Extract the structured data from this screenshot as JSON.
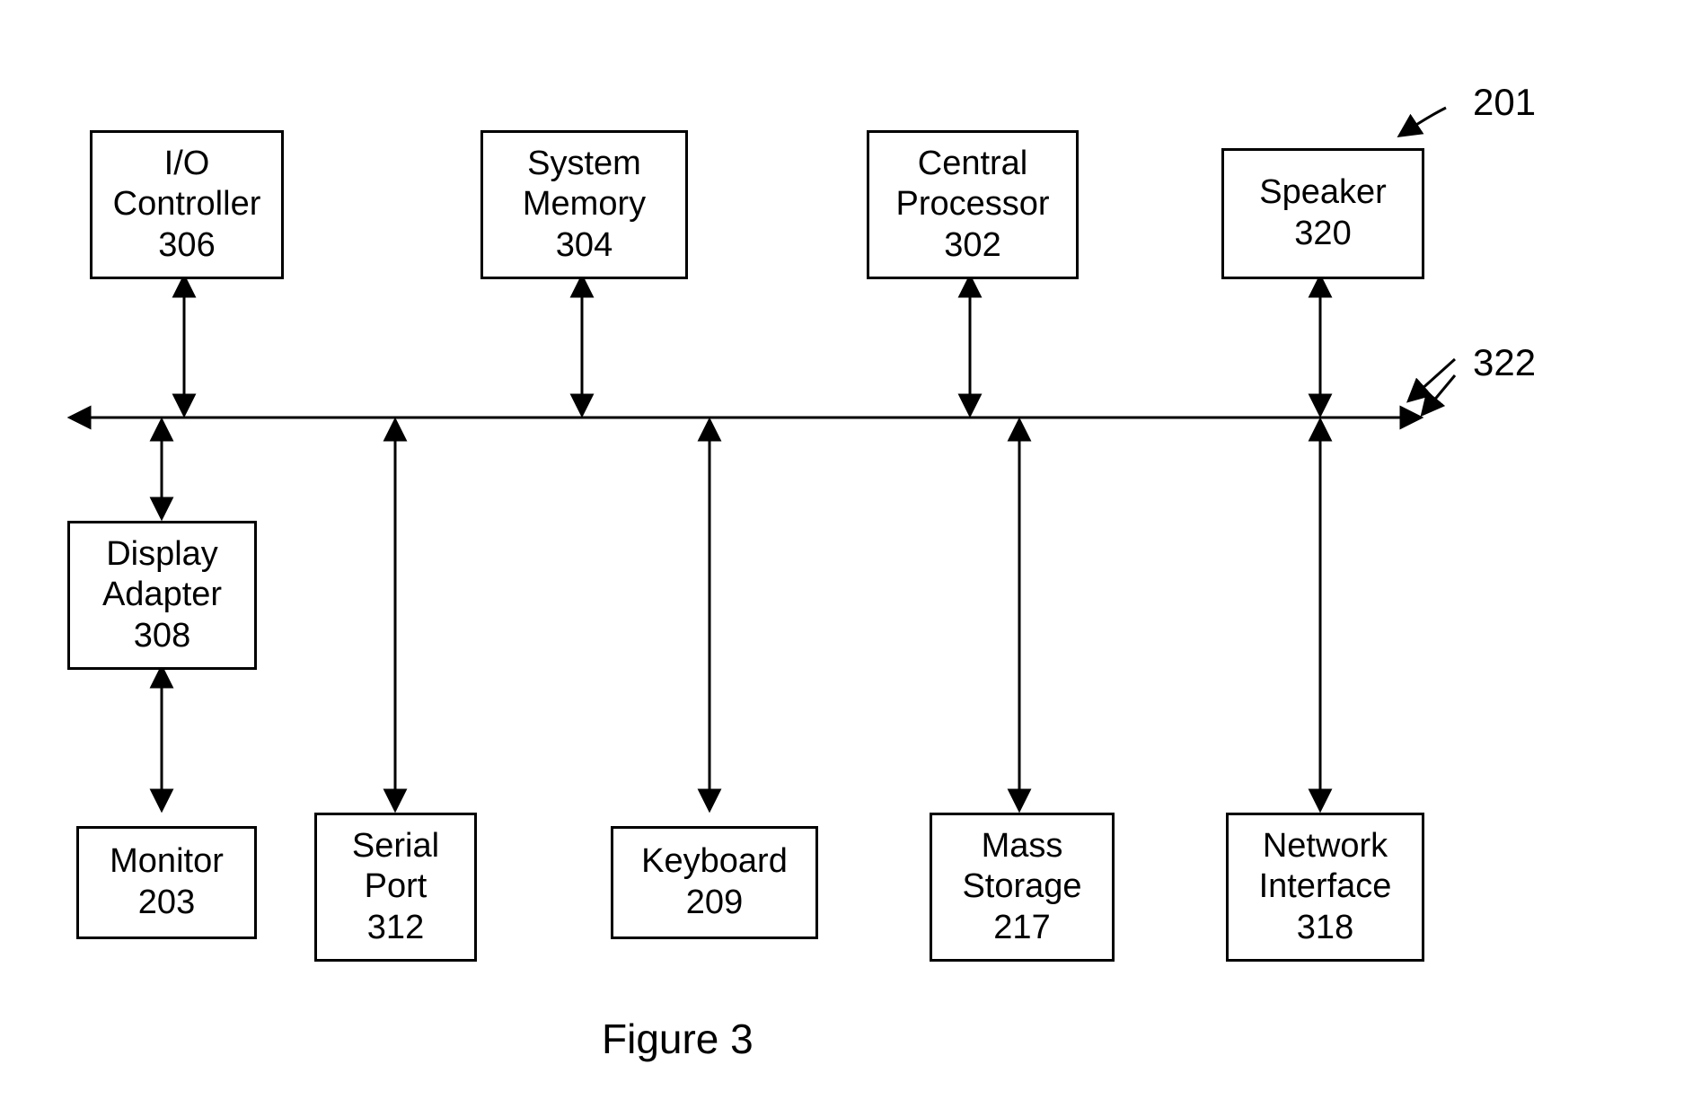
{
  "figure": {
    "caption": "Figure 3",
    "system_ref": "201",
    "bus_ref": "322"
  },
  "top_boxes": {
    "io_controller": {
      "line1": "I/O",
      "line2": "Controller",
      "num": "306"
    },
    "system_memory": {
      "line1": "System",
      "line2": "Memory",
      "num": "304"
    },
    "central_processor": {
      "line1": "Central",
      "line2": "Processor",
      "num": "302"
    },
    "speaker": {
      "line1": "Speaker",
      "num": "320"
    }
  },
  "mid_box": {
    "display_adapter": {
      "line1": "Display",
      "line2": "Adapter",
      "num": "308"
    }
  },
  "bottom_boxes": {
    "monitor": {
      "line1": "Monitor",
      "num": "203"
    },
    "serial_port": {
      "line1": "Serial",
      "line2": "Port",
      "num": "312"
    },
    "keyboard": {
      "line1": "Keyboard",
      "num": "209"
    },
    "mass_storage": {
      "line1": "Mass",
      "line2": "Storage",
      "num": "217"
    },
    "network_interface": {
      "line1": "Network",
      "line2": "Interface",
      "num": "318"
    }
  }
}
